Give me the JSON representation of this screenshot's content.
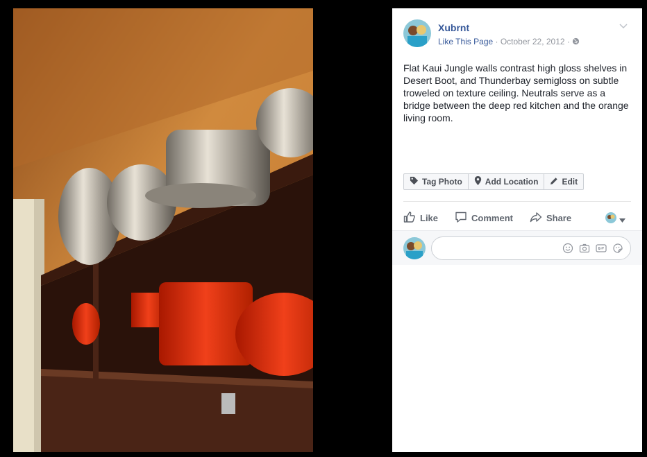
{
  "post": {
    "page_name": "Xubrnt",
    "like_page": "Like This Page",
    "separator": " · ",
    "date": "October 22, 2012",
    "privacy_separator": " · ",
    "caption": "Flat Kaui Jungle walls contrast high gloss shelves in Desert Boot, and Thunderbay semigloss on subtle troweled on texture ceiling. Neutrals serve as a bridge between the deep red kitchen and the orange living room."
  },
  "photo_actions": {
    "tag_photo": "Tag Photo",
    "add_location": "Add Location",
    "edit": "Edit"
  },
  "ufi": {
    "like": "Like",
    "comment": "Comment",
    "share": "Share"
  },
  "comment_box": {
    "placeholder": ""
  },
  "icons": [
    "globe-icon",
    "chevron-down-icon",
    "tag-icon",
    "location-pin-icon",
    "pencil-icon",
    "thumbs-up-icon",
    "comment-icon",
    "share-arrow-icon",
    "emoji-icon",
    "camera-icon",
    "gif-icon",
    "sticker-icon"
  ],
  "colors": {
    "link": "#365899",
    "meta": "#90949c",
    "text": "#1d2129",
    "ufi_text": "#616770"
  }
}
